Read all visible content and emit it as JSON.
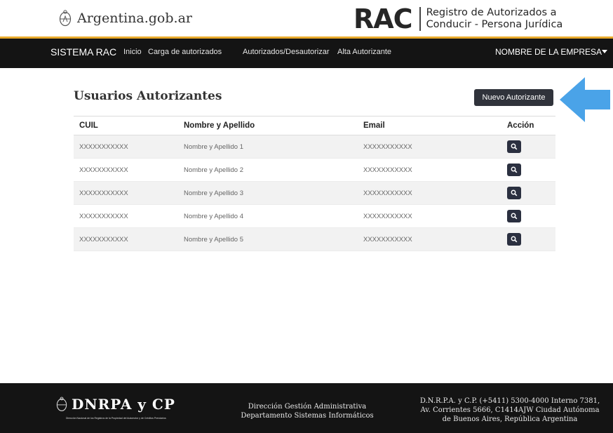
{
  "header": {
    "gov_logo_icon": "argentina-seal-icon",
    "gov_name": "Argentina.gob.ar",
    "brand": "RAC",
    "subtitle_line1": "Registro de Autorizados a",
    "subtitle_line2": "Conducir - Persona Jurídica"
  },
  "nav": {
    "system": "SISTEMA RAC",
    "links": [
      "Inicio",
      "Carga de autorizados",
      "Autorizados/Desautorizar",
      "Alta Autorizante"
    ],
    "company": "NOMBRE DE LA EMPRESA"
  },
  "main": {
    "title": "Usuarios Autorizantes",
    "new_button": "Nuevo Autorizante",
    "arrow_color": "#4aa3e8",
    "columns": [
      "CUIL",
      "Nombre y Apellido",
      "Email",
      "Acción"
    ],
    "rows": [
      {
        "cuil": "XXXXXXXXXXX",
        "name": "Nombre y Apellido 1",
        "email": "XXXXXXXXXXX"
      },
      {
        "cuil": "XXXXXXXXXXX",
        "name": "Nombre y Apellido 2",
        "email": "XXXXXXXXXXX"
      },
      {
        "cuil": "XXXXXXXXXXX",
        "name": "Nombre y Apellido 3",
        "email": "XXXXXXXXXXX"
      },
      {
        "cuil": "XXXXXXXXXXX",
        "name": "Nombre y Apellido 4",
        "email": "XXXXXXXXXXX"
      },
      {
        "cuil": "XXXXXXXXXXX",
        "name": "Nombre y Apellido 5",
        "email": "XXXXXXXXXXX"
      }
    ],
    "action_icon": "search-icon"
  },
  "footer": {
    "brand": "DNRPA y CP",
    "brand_sub": "Dirección Nacional de los Registros de la Propiedad del Automotor y de Créditos Prendarios",
    "center_line1": "Dirección Gestión Administrativa",
    "center_line2": "Departamento Sistemas Informáticos",
    "right_line1": "D.N.R.P.A. y C.P. (+5411) 5300-4000 Interno 7381,",
    "right_line2": "Av. Corrientes 5666, C1414AJW Ciudad Autónoma",
    "right_line3": "de Buenos Aires, República Argentina"
  },
  "colors": {
    "accent_gold": "#e7a92b",
    "nav_bg": "#141414",
    "button_bg": "#30333b"
  }
}
